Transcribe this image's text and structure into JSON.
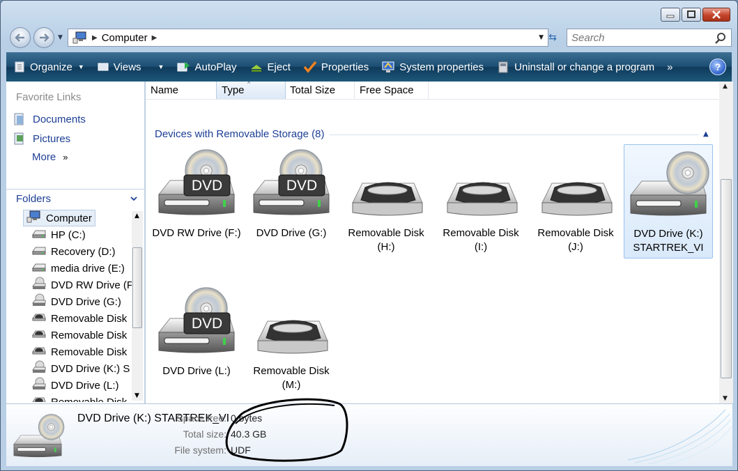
{
  "window": {
    "caption_buttons": [
      "minimize-icon",
      "maximize-icon",
      "close-icon"
    ]
  },
  "nav": {
    "address_crumb": "Computer",
    "search_placeholder": "Search"
  },
  "toolbar": {
    "organize": "Organize",
    "views": "Views",
    "autoplay": "AutoPlay",
    "eject": "Eject",
    "properties": "Properties",
    "system_properties": "System properties",
    "uninstall": "Uninstall or change a program",
    "more": "»",
    "help": "?"
  },
  "sidebar": {
    "favorites_title": "Favorite Links",
    "favorites": [
      {
        "label": "Documents"
      },
      {
        "label": "Pictures"
      },
      {
        "label": "More"
      }
    ],
    "folders_title": "Folders",
    "tree": [
      {
        "label": "Computer",
        "icon": "computer-icon"
      },
      {
        "label": "HP (C:)",
        "icon": "hard-drive-icon"
      },
      {
        "label": "Recovery (D:)",
        "icon": "hard-drive-icon"
      },
      {
        "label": "media drive (E:)",
        "icon": "hard-drive-icon"
      },
      {
        "label": "DVD RW Drive (F",
        "icon": "dvd-drive-icon"
      },
      {
        "label": "DVD Drive (G:)",
        "icon": "dvd-drive-icon"
      },
      {
        "label": "Removable Disk",
        "icon": "removable-disk-icon"
      },
      {
        "label": "Removable Disk",
        "icon": "removable-disk-icon"
      },
      {
        "label": "Removable Disk",
        "icon": "removable-disk-icon"
      },
      {
        "label": "DVD Drive (K:) S",
        "icon": "dvd-drive-icon"
      },
      {
        "label": "DVD Drive (L:)",
        "icon": "dvd-drive-icon"
      },
      {
        "label": "Removable Disk",
        "icon": "removable-disk-icon"
      }
    ]
  },
  "main": {
    "columns": [
      "Name",
      "Type",
      "Total Size",
      "Free Space"
    ],
    "sorted_column": "Type",
    "group_title": "Devices with Removable Storage (8)",
    "items": [
      {
        "line1": "DVD RW Drive (F:)",
        "line2": "",
        "kind": "dvd"
      },
      {
        "line1": "DVD Drive (G:)",
        "line2": "",
        "kind": "dvd"
      },
      {
        "line1": "Removable Disk",
        "line2": "(H:)",
        "kind": "removable"
      },
      {
        "line1": "Removable Disk",
        "line2": "(I:)",
        "kind": "removable"
      },
      {
        "line1": "Removable Disk",
        "line2": "(J:)",
        "kind": "removable"
      },
      {
        "line1": "DVD Drive (K:)",
        "line2": "STARTREK_VI",
        "kind": "cd",
        "selected": true
      },
      {
        "line1": "DVD Drive (L:)",
        "line2": "",
        "kind": "dvd"
      },
      {
        "line1": "Removable Disk",
        "line2": "(M:)",
        "kind": "removable"
      }
    ]
  },
  "details": {
    "name": "DVD Drive (K:) STARTREK_VI",
    "space_free_label": "Space free:",
    "space_free_value": "0 bytes",
    "total_size_label": "Total size:",
    "total_size_value": "40.3 GB",
    "file_system_label": "File system:",
    "file_system_value": "UDF"
  },
  "colors": {
    "toolbar_dark": "#0f3a5c",
    "link_blue": "#1c3e94",
    "annotation_ink": "#000000"
  }
}
